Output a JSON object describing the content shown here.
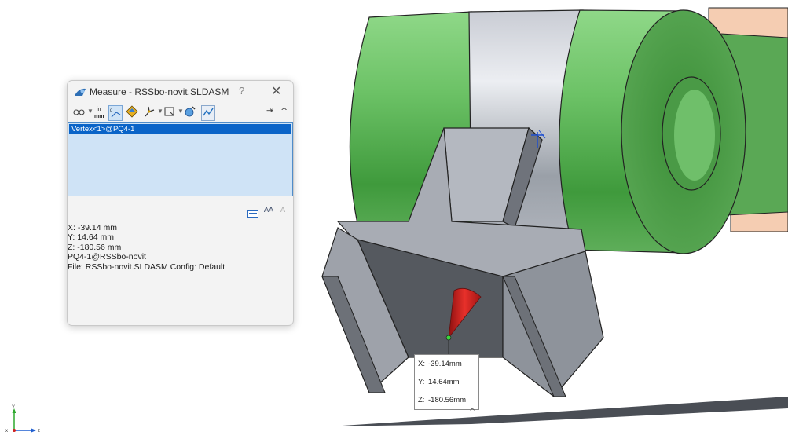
{
  "dialog": {
    "title": "Measure - RSSbo-novit.SLDASM",
    "help_label": "?",
    "close_label": "✕",
    "toolbar": {
      "units_icon_top": "in",
      "units_icon_bottom": "mm",
      "pin_label": "⇥",
      "collapse_label": "^"
    },
    "selection": [
      "Vertex<1>@PQ4-1"
    ],
    "results": {
      "x": "X: -39.14 mm",
      "y": "Y: 14.64 mm",
      "z": "Z: -180.56 mm",
      "component": "PQ4-1@RSSbo-novit",
      "file": "File: RSSbo-novit.SLDASM Config: Default"
    },
    "text_tools": {
      "a": "AA",
      "b": "A"
    }
  },
  "callout": {
    "x_label": "X:",
    "x_value": "-39.14mm",
    "y_label": "Y:",
    "y_value": "14.64mm",
    "z_label": "Z:",
    "z_value": "-180.56mm",
    "expand_label": "^"
  },
  "triad": {
    "x": "x",
    "y": "Y",
    "z": "z"
  },
  "colors": {
    "green_part": "#6ec06a",
    "steel_part": "#b9bfc8",
    "gray_part": "#7a7e86",
    "peach_part": "#f5cdb2",
    "selection_blue": "#0a64c8",
    "cone_red": "#d8221e"
  }
}
